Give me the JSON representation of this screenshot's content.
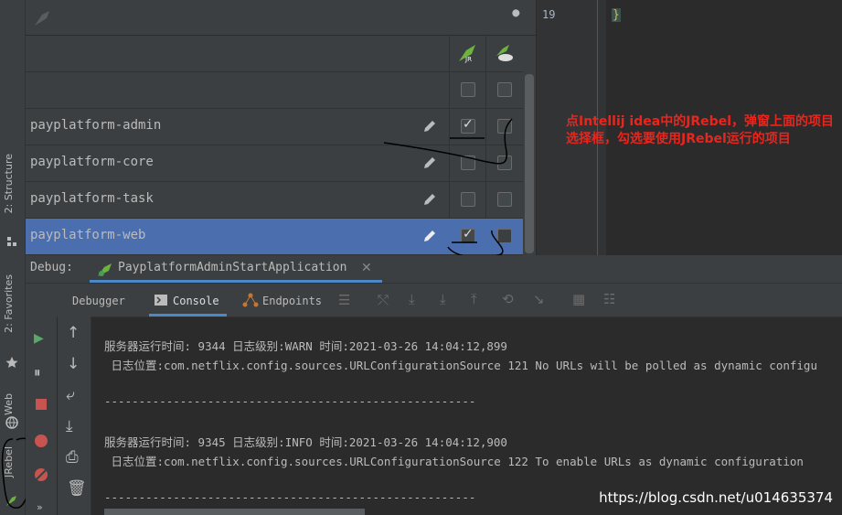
{
  "left_strip": {
    "tabs": [
      "2: Structure",
      "2: Favorites",
      "Web",
      "JRebel"
    ]
  },
  "jrebel_panel": {
    "rows": [
      {
        "name": "",
        "jr": false,
        "remote": false
      },
      {
        "name": "payplatform-admin",
        "jr": true,
        "remote": false
      },
      {
        "name": "payplatform-core",
        "jr": false,
        "remote": false
      },
      {
        "name": "payplatform-task",
        "jr": false,
        "remote": false
      },
      {
        "name": "payplatform-web",
        "jr": true,
        "remote": false,
        "selected": true
      }
    ]
  },
  "editor": {
    "line_number": "19",
    "code": "}"
  },
  "debug": {
    "label": "Debug:",
    "config_name": "PayplatformAdminStartApplication",
    "tabs": [
      "Debugger",
      "Console",
      "Endpoints"
    ]
  },
  "console": {
    "lines": [
      "服务器运行时间: 9344 日志级别:WARN 时间:2021-03-26 14:04:12,899",
      " 日志位置:com.netflix.config.sources.URLConfigurationSource 121 No URLs will be polled as dynamic configu",
      "",
      "------------------------------------------------------",
      "",
      "服务器运行时间: 9345 日志级别:INFO 时间:2021-03-26 14:04:12,900",
      " 日志位置:com.netflix.config.sources.URLConfigurationSource 122 To enable URLs as dynamic configuration",
      "",
      "------------------------------------------------------"
    ]
  },
  "annotation": "点Intellij idea中的JRebel，弹窗上面的项目选择框，勾选要使用JRebel运行的项目",
  "watermark": "https://blog.csdn.net/u014635374",
  "colors": {
    "selected_row": "#4b6eaf",
    "annotation": "#e8261e"
  }
}
